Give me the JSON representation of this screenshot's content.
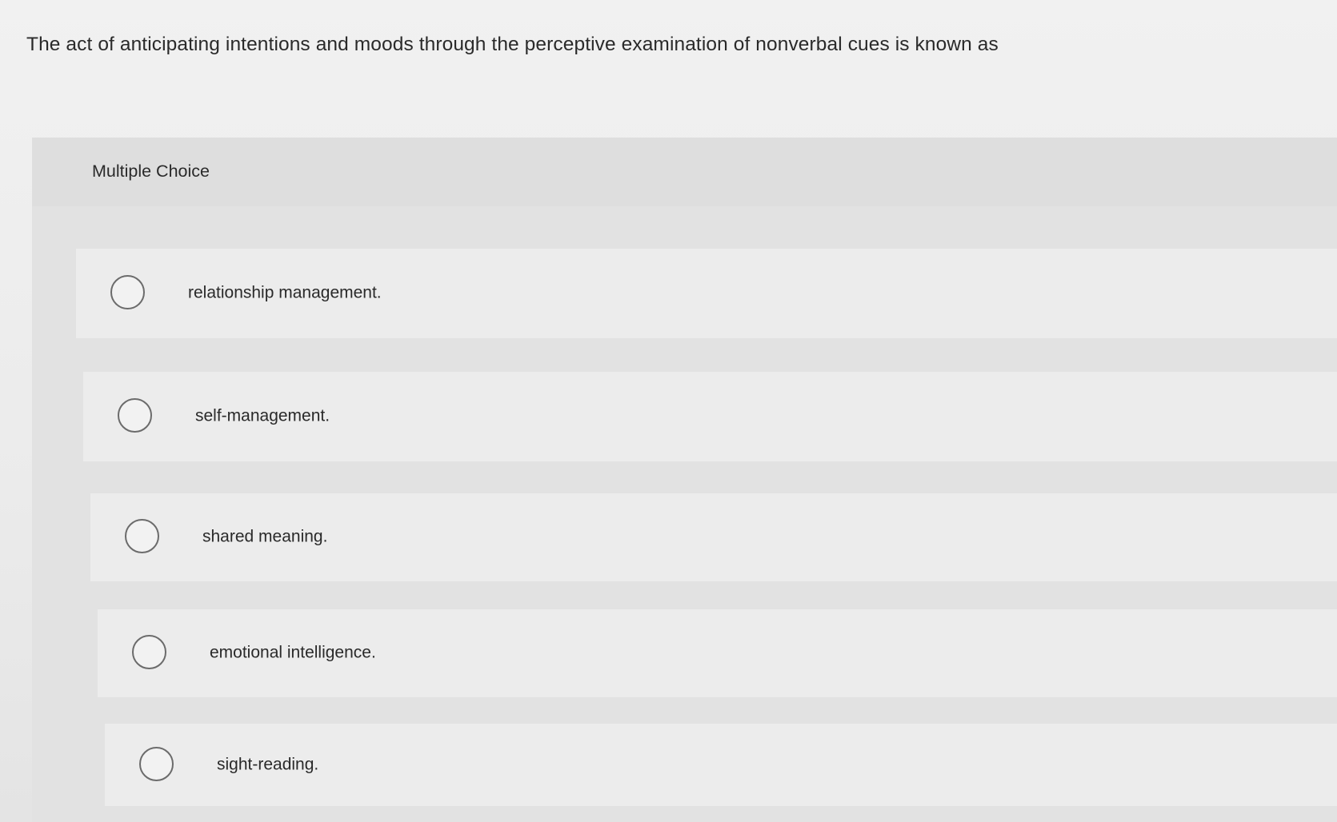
{
  "question": {
    "text": "The act of anticipating intentions and moods through the perceptive examination of nonverbal cues is known as"
  },
  "multiple_choice": {
    "label": "Multiple Choice",
    "options": [
      {
        "label": "relationship management.",
        "selected": false
      },
      {
        "label": "self-management.",
        "selected": false
      },
      {
        "label": "shared meaning.",
        "selected": false
      },
      {
        "label": "emotional intelligence.",
        "selected": false
      },
      {
        "label": "sight-reading.",
        "selected": false
      }
    ]
  }
}
